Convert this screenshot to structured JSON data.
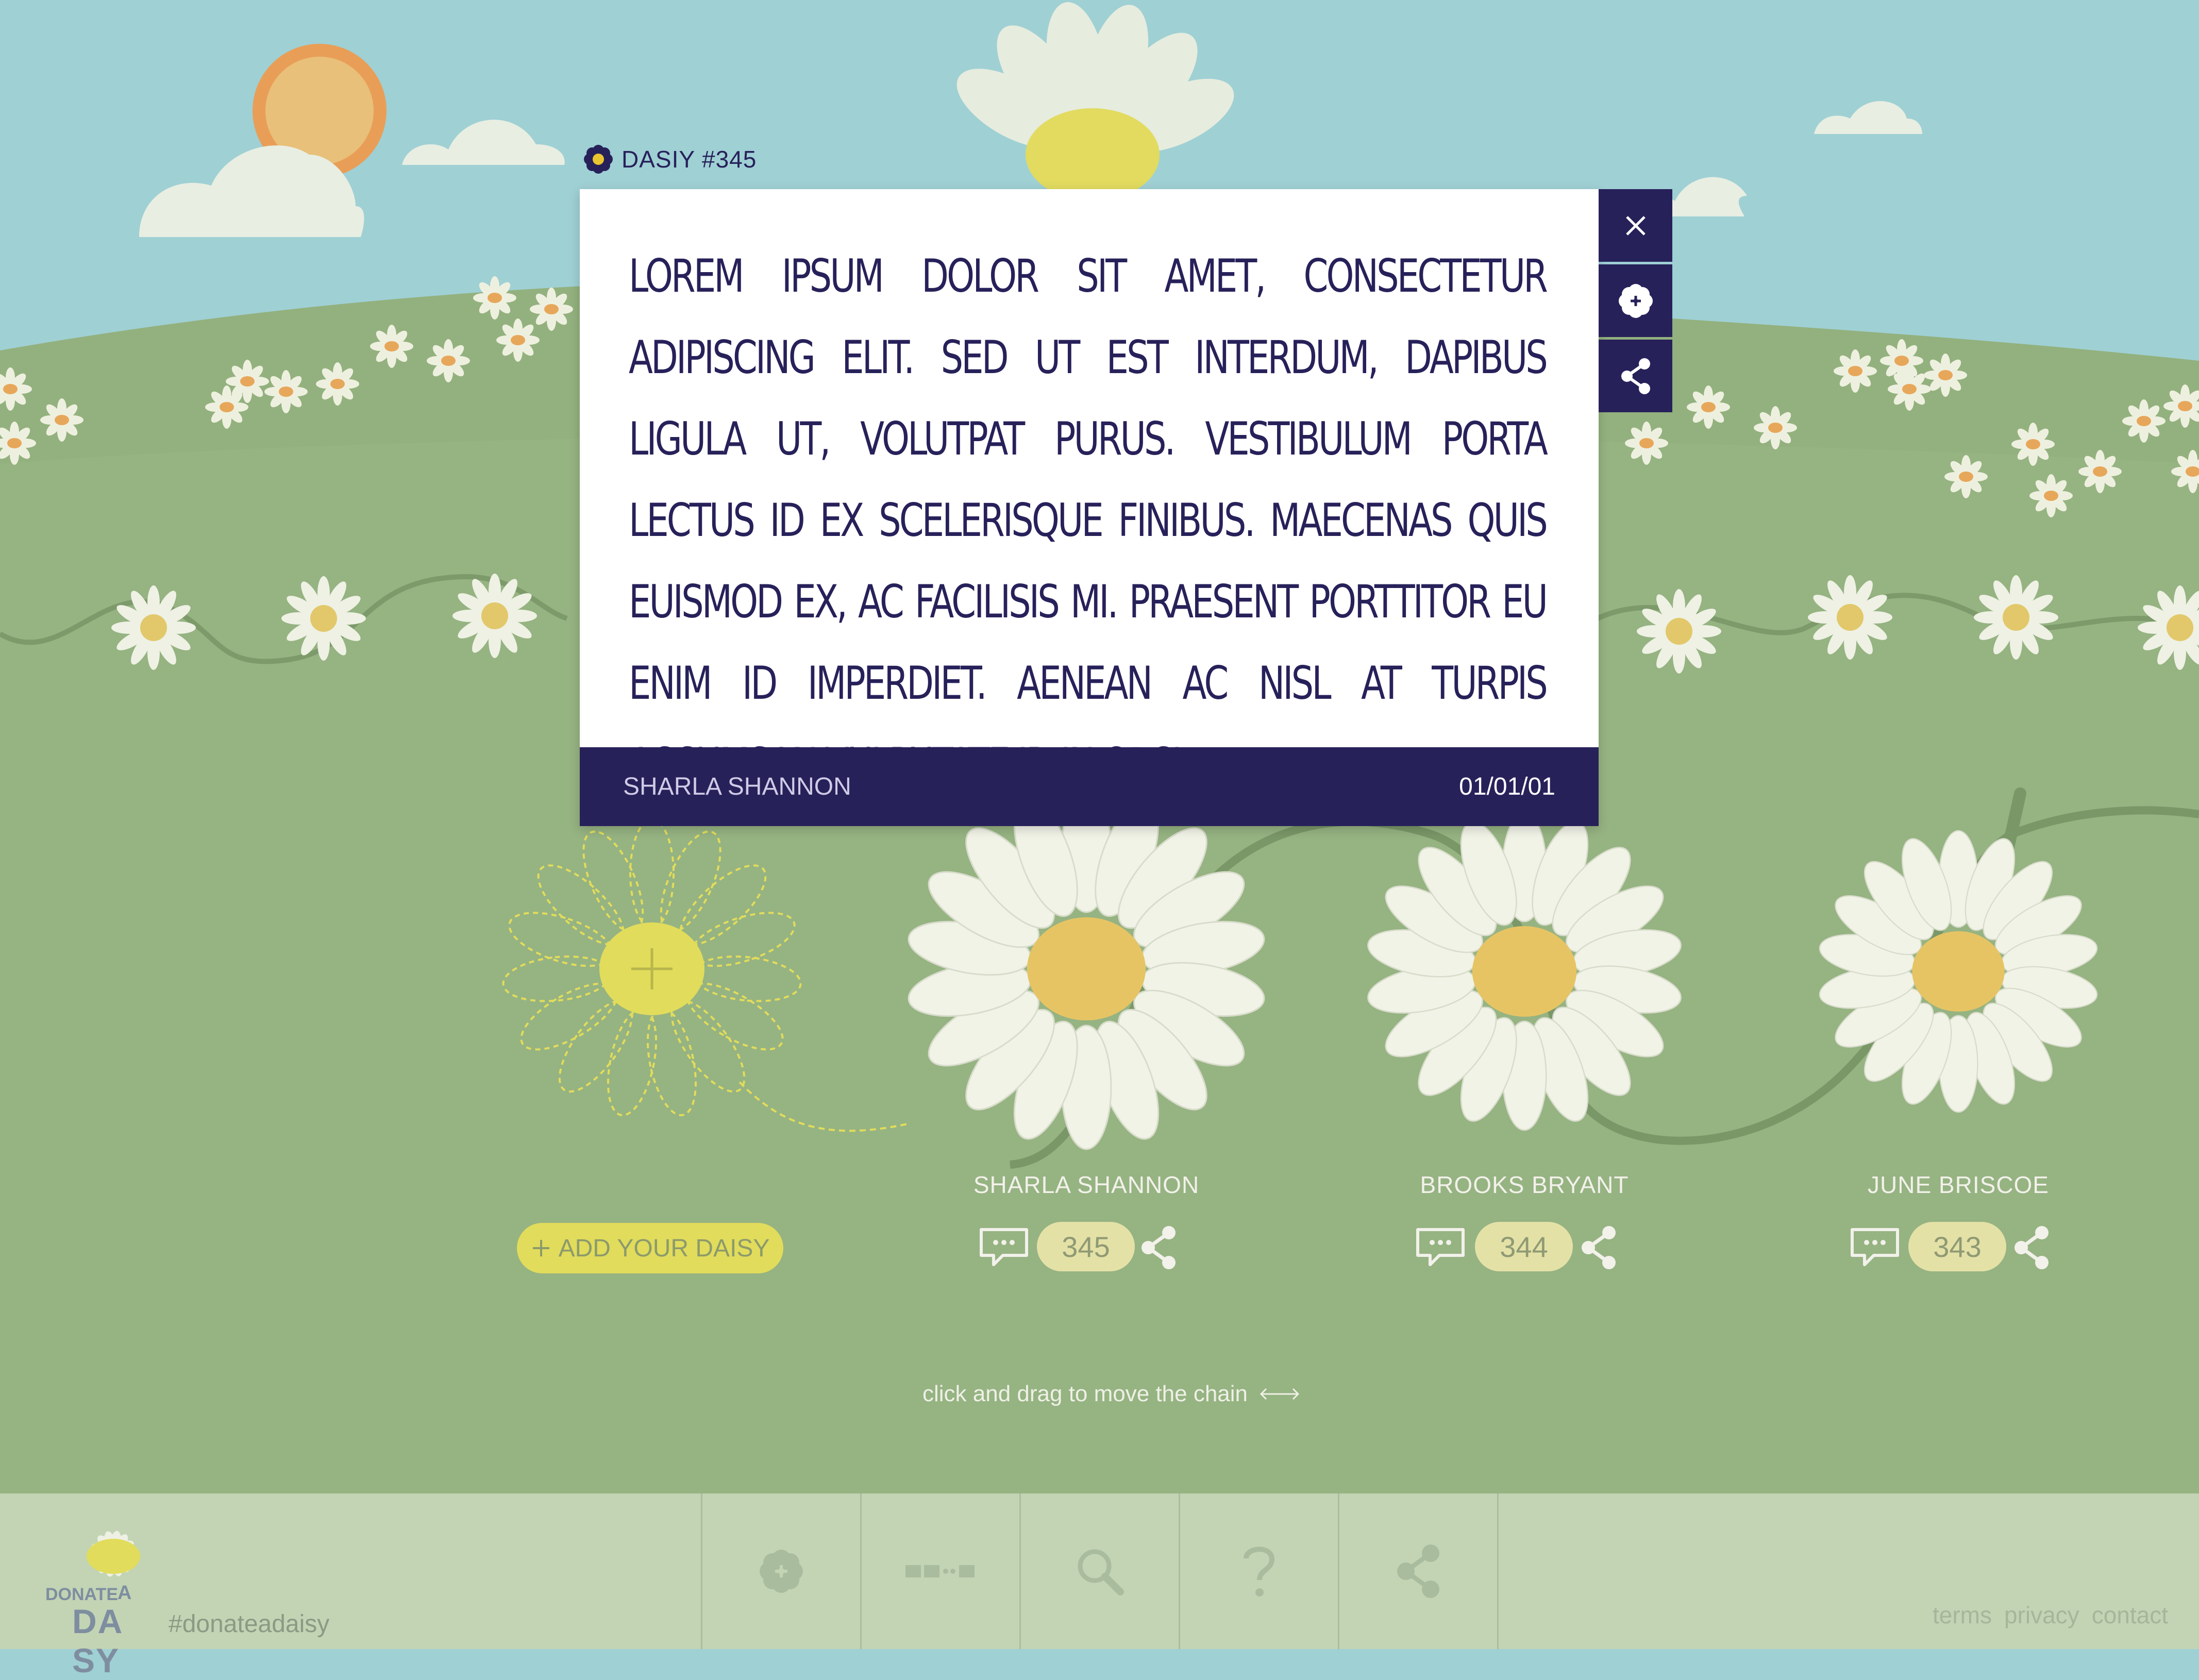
{
  "modal": {
    "tag": "DASIY #345",
    "body": "Lorem ipsum dolor sit amet, consectetur adipiscing elit. Sed ut est interdum, dapibus ligula ut, volutpat purus. Vestibulum porta lectus id ex scelerisque finibus. Maecenas quis euismod ex, ac facilisis mi. Praesent porttitor eu enim id imperdiet. Aenean ac nisl at turpis accumsan vulputate id in orci.",
    "author": "SHARLA SHANNON",
    "date": "01/01/01"
  },
  "modal_actions": {
    "close_icon": "close-icon",
    "daisy_icon": "flower-icon",
    "share_icon": "share-icon"
  },
  "chain": {
    "add_label": "ADD YOUR DAISY",
    "daisies": [
      {
        "name": "SHARLA SHANNON",
        "count": "345"
      },
      {
        "name": "BROOKS BRYANT",
        "count": "344"
      },
      {
        "name": "JUNE BRISCOE",
        "count": "343"
      }
    ],
    "hint": "click and drag to move the chain"
  },
  "footer": {
    "logo_top": "DONATE",
    "logo_a": "A",
    "logo_bottom": "DA SY",
    "hashtag": "#donateadaisy",
    "nav_icons": [
      "flower-icon",
      "chain-icon",
      "search-icon",
      "help-icon",
      "share-icon"
    ],
    "links": [
      "terms",
      "privacy",
      "contact"
    ]
  },
  "colors": {
    "sky": "#9fd0d4",
    "grass": "#93b17e",
    "navy": "#27215a",
    "yellow": "#e1dc5b",
    "footer": "#c2d4b4"
  }
}
